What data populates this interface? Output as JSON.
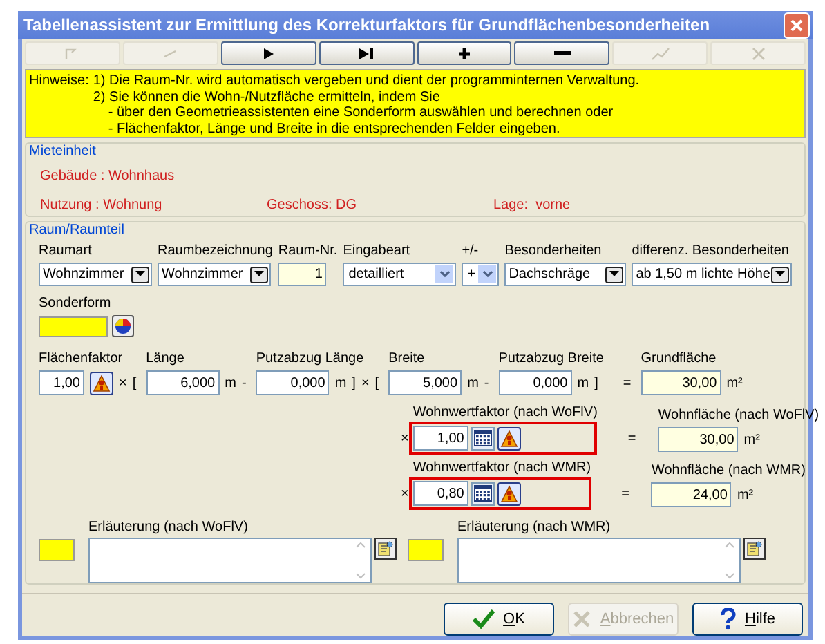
{
  "window": {
    "title": "Tabellenassistent zur Ermittlung des Korrekturfaktors für Grundflächenbesonderheiten"
  },
  "toolbar": [
    {
      "disabled": true
    },
    {
      "disabled": true
    },
    {
      "disabled": false
    },
    {
      "disabled": false
    },
    {
      "disabled": false
    },
    {
      "disabled": false
    },
    {
      "disabled": true
    },
    {
      "disabled": true
    }
  ],
  "hint": {
    "label": "Hinweise:",
    "items": [
      {
        "text": "1) Die Raum-Nr. wird automatisch vergeben und dient der programminternen Verwaltung."
      },
      {
        "text": "2) Sie können die Wohn-/Nutzfläche ermitteln, indem Sie",
        "children": [
          {
            "text": "- über den Geometrieassistenten eine Sonderform auswählen und berechnen oder"
          },
          {
            "text": "- Flächenfaktor, Länge und Breite in die entsprechenden Felder eingeben."
          }
        ]
      }
    ]
  },
  "mieteinheit": {
    "title": "Mieteinheit",
    "rows": [
      [
        "Gebäude : Wohnhaus"
      ],
      [
        "Nutzung : Wohnung",
        "Geschoss: DG",
        "Lage:  vorne"
      ]
    ]
  },
  "raum": {
    "title": "Raum/Raumteil",
    "selectors": [
      {
        "label": "Raumart",
        "value": "Wohnzimmer",
        "kind": "lookup"
      },
      {
        "label": "Raumbezeichnung",
        "value": "Wohnzimmer",
        "kind": "lookup"
      },
      {
        "label": "Raum-Nr.",
        "value": "1",
        "kind": "number"
      },
      {
        "label": "Eingabeart",
        "value": "detailliert",
        "kind": "dropdown"
      },
      {
        "label": "+/-",
        "value": "+",
        "kind": "dropdown"
      },
      {
        "label": "Besonderheiten",
        "value": "Dachschräge",
        "kind": "lookup"
      },
      {
        "label": "differenz. Besonderheiten",
        "value": "ab 1,50 m lichte Höhe",
        "kind": "lookup"
      }
    ],
    "sonderform": {
      "label": "Sonderform"
    },
    "calc": [
      {
        "kind": "field",
        "label": "Flächenfaktor",
        "value": "1,00",
        "helper": true
      },
      {
        "kind": "op",
        "text": "×"
      },
      {
        "kind": "op",
        "text": "["
      },
      {
        "kind": "field",
        "label": "Länge",
        "value": "6,000"
      },
      {
        "kind": "op",
        "text": "m"
      },
      {
        "kind": "op",
        "text": "-"
      },
      {
        "kind": "field",
        "label": "Putzabzug Länge",
        "value": "0,000"
      },
      {
        "kind": "op",
        "text": "m"
      },
      {
        "kind": "op",
        "text": "]"
      },
      {
        "kind": "op",
        "text": "×"
      },
      {
        "kind": "op",
        "text": "["
      },
      {
        "kind": "field",
        "label": "Breite",
        "value": "5,000"
      },
      {
        "kind": "op",
        "text": "m"
      },
      {
        "kind": "op",
        "text": "-"
      },
      {
        "kind": "field",
        "label": "Putzabzug Breite",
        "value": "0,000"
      },
      {
        "kind": "op",
        "text": "m"
      },
      {
        "kind": "op",
        "text": "]"
      },
      {
        "kind": "op",
        "text": "="
      },
      {
        "kind": "result",
        "label": "Grundfläche",
        "value": "30,00"
      },
      {
        "kind": "op",
        "text": "m²"
      }
    ],
    "factors": [
      {
        "op": "×",
        "label": "Wohnwertfaktor (nach WoFlV)",
        "value": "1,00",
        "highlighted": true,
        "eq": "=",
        "result_label": "Wohnfläche (nach WoFlV)",
        "result": "30,00",
        "unit": "m²"
      },
      {
        "op": "×",
        "label": "Wohnwertfaktor (nach WMR)",
        "value": "0,80",
        "highlighted": true,
        "eq": "=",
        "result_label": "Wohnfläche (nach WMR)",
        "result": "24,00",
        "unit": "m²"
      }
    ],
    "notes": [
      {
        "label": "Erläuterung (nach WoFlV)"
      },
      {
        "label": "Erläuterung (nach WMR)"
      }
    ]
  },
  "buttons": [
    {
      "label": "OK",
      "kind": "ok",
      "disabled": false
    },
    {
      "label": "Abbrechen",
      "kind": "cancel",
      "disabled": true
    },
    {
      "label": "Hilfe",
      "kind": "help",
      "disabled": false
    }
  ]
}
